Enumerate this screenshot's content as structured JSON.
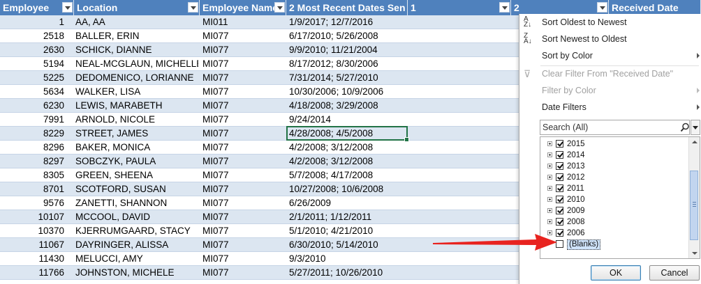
{
  "headers": {
    "employee": "Employee",
    "location": "Location",
    "employee_name": "Employee Name",
    "recent_dates": "2 Most Recent Dates Sen",
    "col1": "1",
    "col2": "2",
    "received_date": "Received Date"
  },
  "rows": [
    {
      "id": "1",
      "location": "AA, AA",
      "name": "MI011",
      "dates": "1/9/2017; 12/7/2016"
    },
    {
      "id": "2518",
      "location": "BALLER, ERIN",
      "name": "MI077",
      "dates": "6/17/2010; 5/26/2008"
    },
    {
      "id": "2630",
      "location": "SCHICK, DIANNE",
      "name": "MI077",
      "dates": "9/9/2010; 11/21/2004"
    },
    {
      "id": "5194",
      "location": "NEAL-MCGLAUN, MICHELLE",
      "name": "MI077",
      "dates": "8/17/2012; 8/30/2006"
    },
    {
      "id": "5225",
      "location": "DEDOMENICO, LORIANNE",
      "name": "MI077",
      "dates": "7/31/2014; 5/27/2010"
    },
    {
      "id": "5634",
      "location": "WALKER, LISA",
      "name": "MI077",
      "dates": "10/30/2006; 10/9/2006"
    },
    {
      "id": "6230",
      "location": "LEWIS, MARABETH",
      "name": "MI077",
      "dates": "4/18/2008; 3/29/2008"
    },
    {
      "id": "7991",
      "location": "ARNOLD, NICOLE",
      "name": "MI077",
      "dates": "9/24/2014"
    },
    {
      "id": "8229",
      "location": "STREET, JAMES",
      "name": "MI077",
      "dates": "4/28/2008; 4/5/2008"
    },
    {
      "id": "8296",
      "location": "BAKER, MONICA",
      "name": "MI077",
      "dates": "4/2/2008; 3/12/2008"
    },
    {
      "id": "8297",
      "location": "SOBCZYK, PAULA",
      "name": "MI077",
      "dates": "4/2/2008; 3/12/2008"
    },
    {
      "id": "8305",
      "location": "GREEN, SHEENA",
      "name": "MI077",
      "dates": "5/7/2008; 4/17/2008"
    },
    {
      "id": "8701",
      "location": "SCOTFORD, SUSAN",
      "name": "MI077",
      "dates": "10/27/2008; 10/6/2008"
    },
    {
      "id": "9576",
      "location": "ZANETTI, SHANNON",
      "name": "MI077",
      "dates": "6/26/2009"
    },
    {
      "id": "10107",
      "location": "MCCOOL, DAVID",
      "name": "MI077",
      "dates": "2/1/2011; 1/12/2011"
    },
    {
      "id": "10370",
      "location": "KJERRUMGAARD, STACY",
      "name": "MI077",
      "dates": "5/1/2010; 4/21/2010"
    },
    {
      "id": "11067",
      "location": "DAYRINGER, ALISSA",
      "name": "MI077",
      "dates": "6/30/2010; 5/14/2010"
    },
    {
      "id": "11430",
      "location": "MELUCCI, AMY",
      "name": "MI077",
      "dates": "9/3/2010"
    },
    {
      "id": "11766",
      "location": "JOHNSTON, MICHELE",
      "name": "MI077",
      "dates": "5/27/2011; 10/26/2010"
    }
  ],
  "menu": {
    "sort_oldest": "Sort Oldest to Newest",
    "sort_newest": "Sort Newest to Oldest",
    "sort_color": "Sort by Color",
    "clear_filter": "Clear Filter From \"Received Date\"",
    "filter_color": "Filter by Color",
    "date_filters": "Date Filters",
    "search_placeholder": "Search (All)",
    "years": [
      {
        "label": "2015",
        "checked": true
      },
      {
        "label": "2014",
        "checked": true
      },
      {
        "label": "2013",
        "checked": true
      },
      {
        "label": "2012",
        "checked": true
      },
      {
        "label": "2011",
        "checked": true
      },
      {
        "label": "2010",
        "checked": true
      },
      {
        "label": "2009",
        "checked": true
      },
      {
        "label": "2008",
        "checked": true
      },
      {
        "label": "2006",
        "checked": true
      }
    ],
    "blanks": "(Blanks)",
    "ok": "OK",
    "cancel": "Cancel"
  },
  "colors": {
    "header_bg": "#4f81bd",
    "band_bg": "#dce6f1",
    "selection_border": "#217346",
    "annotation_arrow": "#e8231f"
  }
}
